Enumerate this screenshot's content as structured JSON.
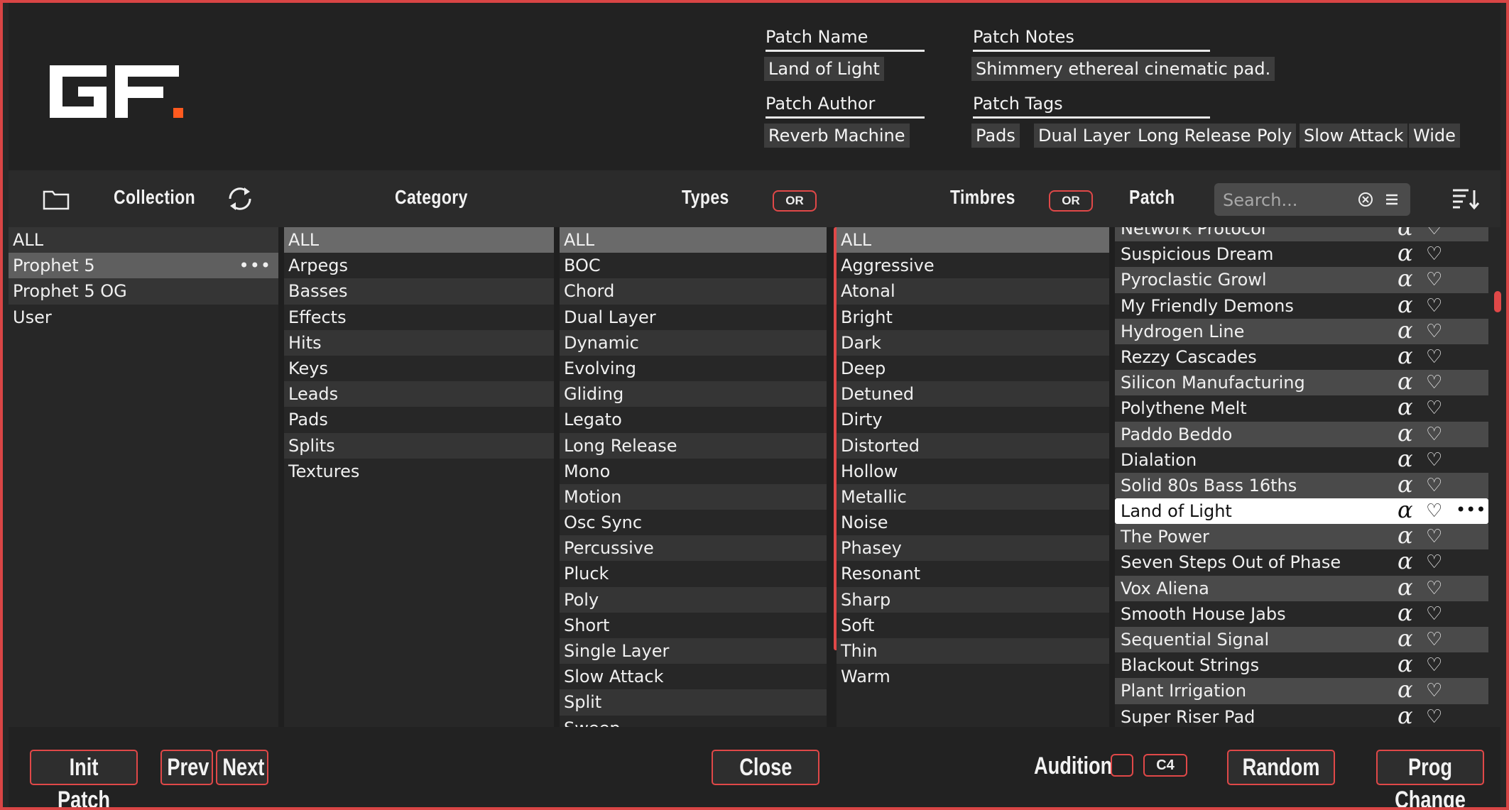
{
  "header": {
    "patch_name_label": "Patch Name",
    "patch_name": "Land of Light",
    "patch_notes_label": "Patch Notes",
    "patch_notes": "Shimmery ethereal cinematic pad.",
    "patch_author_label": "Patch Author",
    "patch_author": "Reverb Machine",
    "patch_tags_label": "Patch Tags",
    "patch_tags": [
      "Pads",
      "Dual Layer",
      "Long Release",
      "Poly",
      "Slow Attack",
      "Wide"
    ]
  },
  "columns": {
    "collection": "Collection",
    "category": "Category",
    "types": "Types",
    "types_mode": "OR",
    "timbres": "Timbres",
    "timbres_mode": "OR",
    "patch": "Patch",
    "search_placeholder": "Search..."
  },
  "collections": [
    "ALL",
    "Prophet 5",
    "Prophet 5 OG",
    "User"
  ],
  "collection_selected": "Prophet 5",
  "categories": [
    "ALL",
    "Arpegs",
    "Basses",
    "Effects",
    "Hits",
    "Keys",
    "Leads",
    "Pads",
    "Splits",
    "Textures"
  ],
  "types": [
    "ALL",
    "BOC",
    "Chord",
    "Dual Layer",
    "Dynamic",
    "Evolving",
    "Gliding",
    "Legato",
    "Long Release",
    "Mono",
    "Motion",
    "Osc Sync",
    "Percussive",
    "Pluck",
    "Poly",
    "Short",
    "Single Layer",
    "Slow Attack",
    "Split",
    "Sweep"
  ],
  "timbres": [
    "ALL",
    "Aggressive",
    "Atonal",
    "Bright",
    "Dark",
    "Deep",
    "Detuned",
    "Dirty",
    "Distorted",
    "Hollow",
    "Metallic",
    "Noise",
    "Phasey",
    "Resonant",
    "Sharp",
    "Soft",
    "Thin",
    "Warm"
  ],
  "patches": [
    "Network Protocol",
    "Suspicious Dream",
    "Pyroclastic Growl",
    "My Friendly Demons",
    "Hydrogen Line",
    "Rezzy Cascades",
    "Silicon Manufacturing",
    "Polythene Melt",
    "Paddo Beddo",
    "Dialation",
    "Solid 80s Bass 16ths",
    "Land of Light",
    "The Power",
    "Seven Steps Out of Phase",
    "Vox Aliena",
    "Smooth House Jabs",
    "Sequential Signal",
    "Blackout Strings",
    "Plant Irrigation",
    "Super Riser Pad"
  ],
  "patch_current": "Land of Light",
  "icons": {
    "folder": "folder-icon",
    "refresh": "refresh-icon",
    "clear": "clear-search-icon",
    "menu": "menu-icon",
    "sort": "sort-icon",
    "alpha": "α",
    "heart": "♡",
    "more": "•••"
  },
  "footer": {
    "init_patch": "Init Patch",
    "prev": "Prev",
    "next": "Next",
    "close": "Close",
    "audition": "Audition",
    "audition_note": "C4",
    "random": "Random",
    "prog_change": "Prog Change"
  },
  "colors": {
    "accent": "#e04848",
    "selected_row": "#ffffff",
    "background": "#272727"
  }
}
